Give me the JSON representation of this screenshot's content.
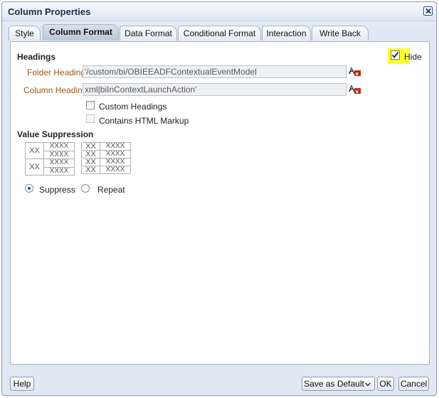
{
  "dialog": {
    "title": "Column Properties",
    "close_icon": "close-icon"
  },
  "tabs": [
    {
      "label": "Style"
    },
    {
      "label": "Column Format",
      "active": true
    },
    {
      "label": "Data Format"
    },
    {
      "label": "Conditional Format"
    },
    {
      "label": "Interaction"
    },
    {
      "label": "Write Back"
    }
  ],
  "headings": {
    "title": "Headings",
    "hide_label": "Hide",
    "hide_checked": true,
    "folder_heading_label": "Folder Heading",
    "folder_heading_value": "'/custom/bi/OBIEEADFContextualEventModel",
    "column_heading_label": "Column Heading",
    "column_heading_value": "xml|biInContextLaunchAction'",
    "custom_headings_label": "Custom Headings",
    "contains_html_label": "Contains HTML Markup",
    "edit_formula_icon": "edit-formula-icon"
  },
  "value_suppression": {
    "title": "Value Suppression",
    "sample_big": "XX",
    "sample_small": "XXXX",
    "suppress_label": "Suppress",
    "repeat_label": "Repeat",
    "selected": "Suppress"
  },
  "footer": {
    "help": "Help",
    "save_default": "Save as Default",
    "ok": "OK",
    "cancel": "Cancel"
  }
}
